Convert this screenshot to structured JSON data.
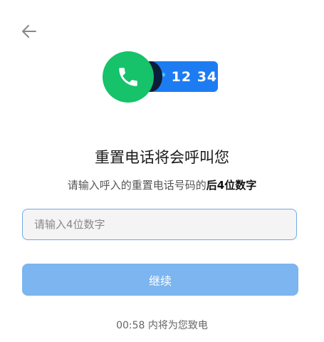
{
  "colors": {
    "primary_button": "#7cb5ef",
    "input_border": "#6fa8e6",
    "phone_circle": "#16c26a",
    "number_pill": "#1e7cf2"
  },
  "icons": {
    "back": "arrow-left-icon",
    "phone": "phone-icon"
  },
  "hero": {
    "masked_prefix": "**",
    "digits": "12 34"
  },
  "title": "重置电话将会呼叫您",
  "subtitle": {
    "prefix": "请输入呼入的重置电话号码的",
    "emphasis": "后4位数字"
  },
  "code_input": {
    "placeholder": "请输入4位数字",
    "value": ""
  },
  "continue_button": "继续",
  "timer": {
    "countdown": "00:58",
    "suffix": "内将为您致电"
  }
}
